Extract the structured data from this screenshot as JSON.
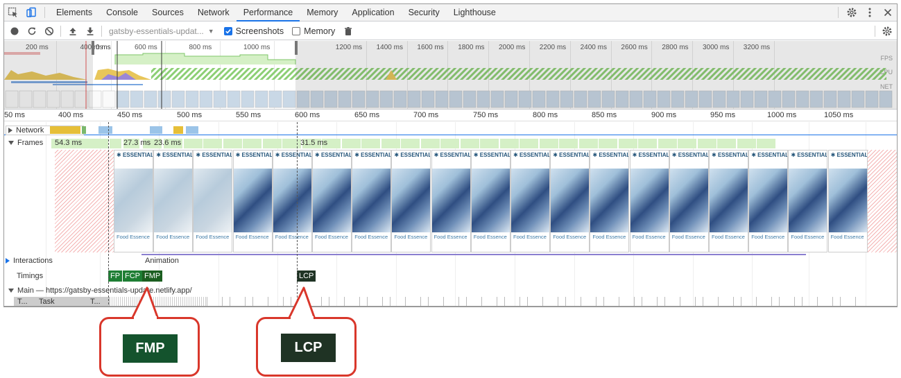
{
  "tabs": [
    "Elements",
    "Console",
    "Sources",
    "Network",
    "Performance",
    "Memory",
    "Application",
    "Security",
    "Lighthouse"
  ],
  "active_tab": "Performance",
  "toolbar": {
    "profile_select": "gatsby-essentials-updat...",
    "screenshots_label": "Screenshots",
    "screenshots_checked": true,
    "memory_label": "Memory",
    "memory_checked": false
  },
  "overview": {
    "tick_labels": [
      "200 ms",
      "400 ms",
      "600 ms",
      "800 ms",
      "1000 ms",
      "1200 ms",
      "1400 ms",
      "1600 ms",
      "1800 ms",
      "2000 ms",
      "2200 ms",
      "2400 ms",
      "2600 ms",
      "2800 ms",
      "3000 ms",
      "3200 ms"
    ],
    "selection_start_label": "0 ms",
    "row_labels": [
      "FPS",
      "CPU",
      "NET"
    ]
  },
  "ruler": {
    "labels": [
      "50 ms",
      "400 ms",
      "450 ms",
      "500 ms",
      "550 ms",
      "600 ms",
      "650 ms",
      "700 ms",
      "750 ms",
      "800 ms",
      "850 ms",
      "900 ms",
      "950 ms",
      "1000 ms",
      "1050 ms"
    ]
  },
  "tracks": {
    "network": "Network",
    "frames": "Frames",
    "frame_labels": [
      "54.3 ms",
      "27.3 ms",
      "23.6 ms",
      "31.5 ms"
    ],
    "interactions": "Interactions",
    "animation": "Animation",
    "timings": "Timings",
    "main": "Main — https://gatsby-essentials-update.netlify.app/",
    "main_col1": "T...",
    "main_col2": "Task",
    "main_col3": "T..."
  },
  "thumb": {
    "brand": "ESSENTIALS",
    "footer": "Food Essence"
  },
  "timings": [
    "FP",
    "FCP",
    "FMP",
    "LCP"
  ],
  "colors": {
    "fp": "#1e7e34",
    "fcp": "#1e7e34",
    "fmp": "#1b5e20",
    "lcp": "#1f3324",
    "accent": "#1a73e8",
    "callout_border": "#d9372b"
  },
  "callouts": {
    "fmp": "FMP",
    "lcp": "LCP"
  }
}
